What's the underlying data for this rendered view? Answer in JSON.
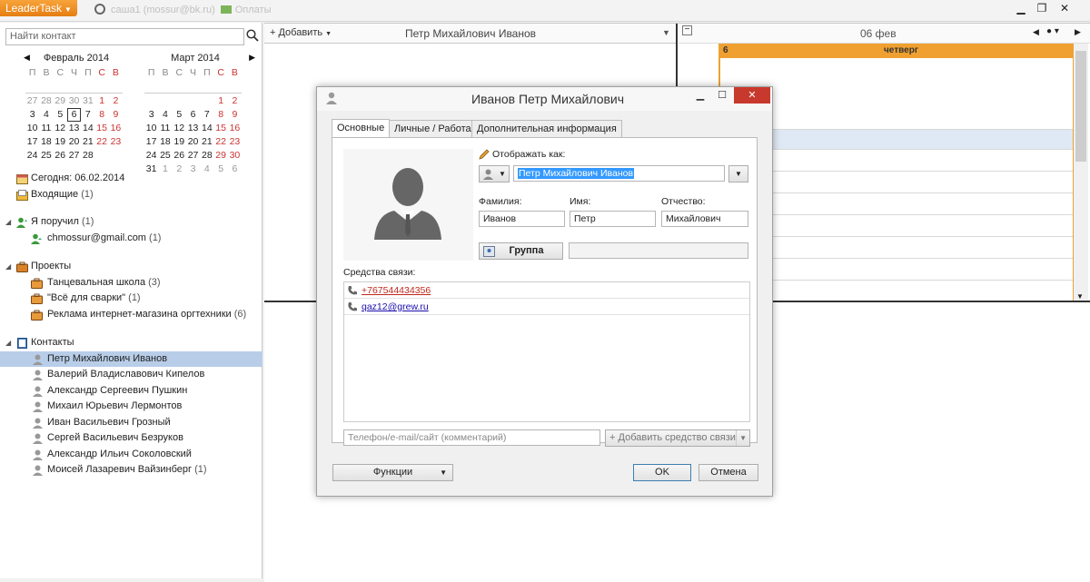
{
  "app": {
    "menu_label": "LeaderTask",
    "window_title": "саша1 (mossur@bk.ru)",
    "window_title_extra": "Оплаты"
  },
  "sidebar": {
    "search_placeholder": "Найти контакт",
    "calendars": [
      {
        "title": "Февраль 2014",
        "dow": [
          "П",
          "В",
          "С",
          "Ч",
          "П",
          "С",
          "В"
        ],
        "weeks": [
          [
            {
              "d": "27",
              "o": true
            },
            {
              "d": "28",
              "o": true
            },
            {
              "d": "29",
              "o": true
            },
            {
              "d": "30",
              "o": true
            },
            {
              "d": "31",
              "o": true
            },
            {
              "d": "1",
              "w": true
            },
            {
              "d": "2",
              "w": true
            }
          ],
          [
            {
              "d": "3"
            },
            {
              "d": "4"
            },
            {
              "d": "5"
            },
            {
              "d": "6",
              "t": true
            },
            {
              "d": "7"
            },
            {
              "d": "8",
              "w": true
            },
            {
              "d": "9",
              "w": true
            }
          ],
          [
            {
              "d": "10"
            },
            {
              "d": "11"
            },
            {
              "d": "12"
            },
            {
              "d": "13"
            },
            {
              "d": "14"
            },
            {
              "d": "15",
              "w": true
            },
            {
              "d": "16",
              "w": true
            }
          ],
          [
            {
              "d": "17"
            },
            {
              "d": "18"
            },
            {
              "d": "19"
            },
            {
              "d": "20"
            },
            {
              "d": "21"
            },
            {
              "d": "22",
              "w": true
            },
            {
              "d": "23",
              "w": true
            }
          ],
          [
            {
              "d": "24"
            },
            {
              "d": "25"
            },
            {
              "d": "26"
            },
            {
              "d": "27"
            },
            {
              "d": "28"
            },
            {
              "d": ""
            },
            {
              "d": ""
            }
          ]
        ]
      },
      {
        "title": "Март 2014",
        "dow": [
          "П",
          "В",
          "С",
          "Ч",
          "П",
          "С",
          "В"
        ],
        "weeks": [
          [
            {
              "d": ""
            },
            {
              "d": ""
            },
            {
              "d": ""
            },
            {
              "d": ""
            },
            {
              "d": ""
            },
            {
              "d": "1",
              "w": true
            },
            {
              "d": "2",
              "w": true
            }
          ],
          [
            {
              "d": "3"
            },
            {
              "d": "4"
            },
            {
              "d": "5"
            },
            {
              "d": "6"
            },
            {
              "d": "7"
            },
            {
              "d": "8",
              "w": true
            },
            {
              "d": "9",
              "w": true
            }
          ],
          [
            {
              "d": "10"
            },
            {
              "d": "11"
            },
            {
              "d": "12"
            },
            {
              "d": "13"
            },
            {
              "d": "14"
            },
            {
              "d": "15",
              "w": true
            },
            {
              "d": "16",
              "w": true
            }
          ],
          [
            {
              "d": "17"
            },
            {
              "d": "18"
            },
            {
              "d": "19"
            },
            {
              "d": "20"
            },
            {
              "d": "21"
            },
            {
              "d": "22",
              "w": true
            },
            {
              "d": "23",
              "w": true
            }
          ],
          [
            {
              "d": "24"
            },
            {
              "d": "25"
            },
            {
              "d": "26"
            },
            {
              "d": "27"
            },
            {
              "d": "28"
            },
            {
              "d": "29",
              "w": true
            },
            {
              "d": "30",
              "w": true
            }
          ],
          [
            {
              "d": "31"
            },
            {
              "d": "1",
              "o": true
            },
            {
              "d": "2",
              "o": true
            },
            {
              "d": "3",
              "o": true
            },
            {
              "d": "4",
              "o": true
            },
            {
              "d": "5",
              "o": true
            },
            {
              "d": "6",
              "o": true
            }
          ]
        ]
      }
    ],
    "today_label": "Сегодня: 06.02.2014",
    "inbox_label": "Входящие",
    "inbox_count": "(1)",
    "delegated_label": "Я поручил",
    "delegated_count": "(1)",
    "delegated_items": [
      {
        "label": "chmossur@gmail.com",
        "count": "(1)"
      }
    ],
    "projects_label": "Проекты",
    "projects": [
      {
        "label": "Танцевальная школа",
        "count": "(3)"
      },
      {
        "label": "\"Всё для сварки\"",
        "count": "(1)"
      },
      {
        "label": "Реклама интернет-магазина оргтехники",
        "count": "(6)"
      }
    ],
    "contacts_label": "Контакты",
    "contacts": [
      {
        "label": "Петр Михайлович Иванов",
        "count": ""
      },
      {
        "label": "Валерий Владиславович Кипелов",
        "count": ""
      },
      {
        "label": "Александр Сергеевич Пушкин",
        "count": ""
      },
      {
        "label": "Михаил Юрьевич Лермонтов",
        "count": ""
      },
      {
        "label": "Иван Васильевич Грозный",
        "count": ""
      },
      {
        "label": "Сергей Васильевич Безруков",
        "count": ""
      },
      {
        "label": "Александр Ильич Соколовский",
        "count": ""
      },
      {
        "label": "Моисей Лазаревич Вайзинберг",
        "count": "(1)"
      }
    ]
  },
  "main": {
    "add_label": "Добавить",
    "contact_title": "Петр Михайлович Иванов",
    "cal_date": "06 фев",
    "day_number": "6",
    "day_name": "четверг"
  },
  "dialog": {
    "title": "Иванов Петр Михайлович",
    "tabs": [
      "Основные",
      "Личные / Работа",
      "Дополнительная информация"
    ],
    "display_as_label": "Отображать как:",
    "display_as_value": "Петр Михайлович Иванов",
    "surname_label": "Фамилия:",
    "surname_value": "Иванов",
    "name_label": "Имя:",
    "name_value": "Петр",
    "patronymic_label": "Отчество:",
    "patronymic_value": "Михайлович",
    "group_button": "Группа",
    "group_value": "",
    "comm_label": "Средства связи:",
    "comm_items": [
      "+767544434356",
      "qaz12@grew.ru"
    ],
    "comm_placeholder": "Телефон/e-mail/сайт (комментарий)",
    "add_comm_label": "Добавить средство связи",
    "functions_label": "Функции",
    "ok_label": "OK",
    "cancel_label": "Отмена"
  }
}
